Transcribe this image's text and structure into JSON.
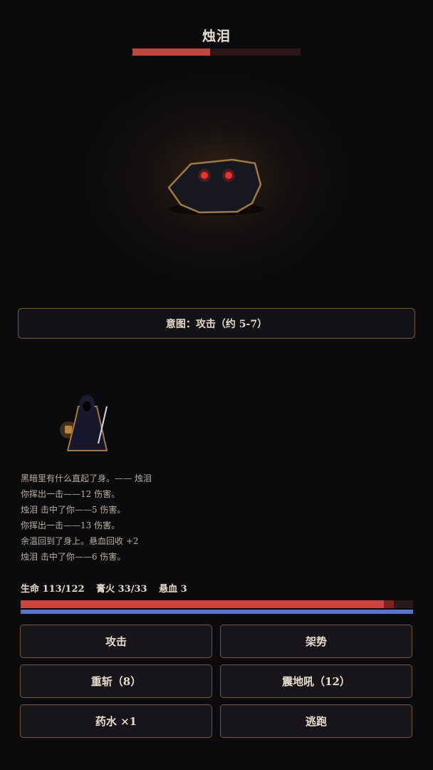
{
  "enemy": {
    "name": "烛泪",
    "hp_fraction": 0.46,
    "intent": "意图：攻击（约 5-7）"
  },
  "log": [
    "黑暗里有什么直起了身。—— 烛泪",
    "你挥出一击——12 伤害。",
    "烛泪 击中了你——5 伤害。",
    "你挥出一击——13 伤害。",
    "余温回到了身上。悬血回收 +2",
    "烛泪 击中了你——6 伤害。"
  ],
  "player": {
    "hp_label": "生命 113/122",
    "fire_label": "膏火 33/33",
    "blood_label": "悬血 3",
    "hp": 113,
    "hp_max": 122,
    "hp_pending_loss": 3,
    "fire": 33,
    "fire_max": 33
  },
  "actions": {
    "attack": "攻击",
    "stance": "架势",
    "heavy_slash": "重斩（8）",
    "quake_roar": "震地吼（12）",
    "potion": "药水 ×1",
    "flee": "逃跑"
  },
  "colors": {
    "enemy_hp": "#c2483f",
    "player_hp": "#c9463f",
    "player_fire": "#5a72c8",
    "accent_border": "#6e5a3c",
    "enemy_eyes": "#e0302a"
  }
}
